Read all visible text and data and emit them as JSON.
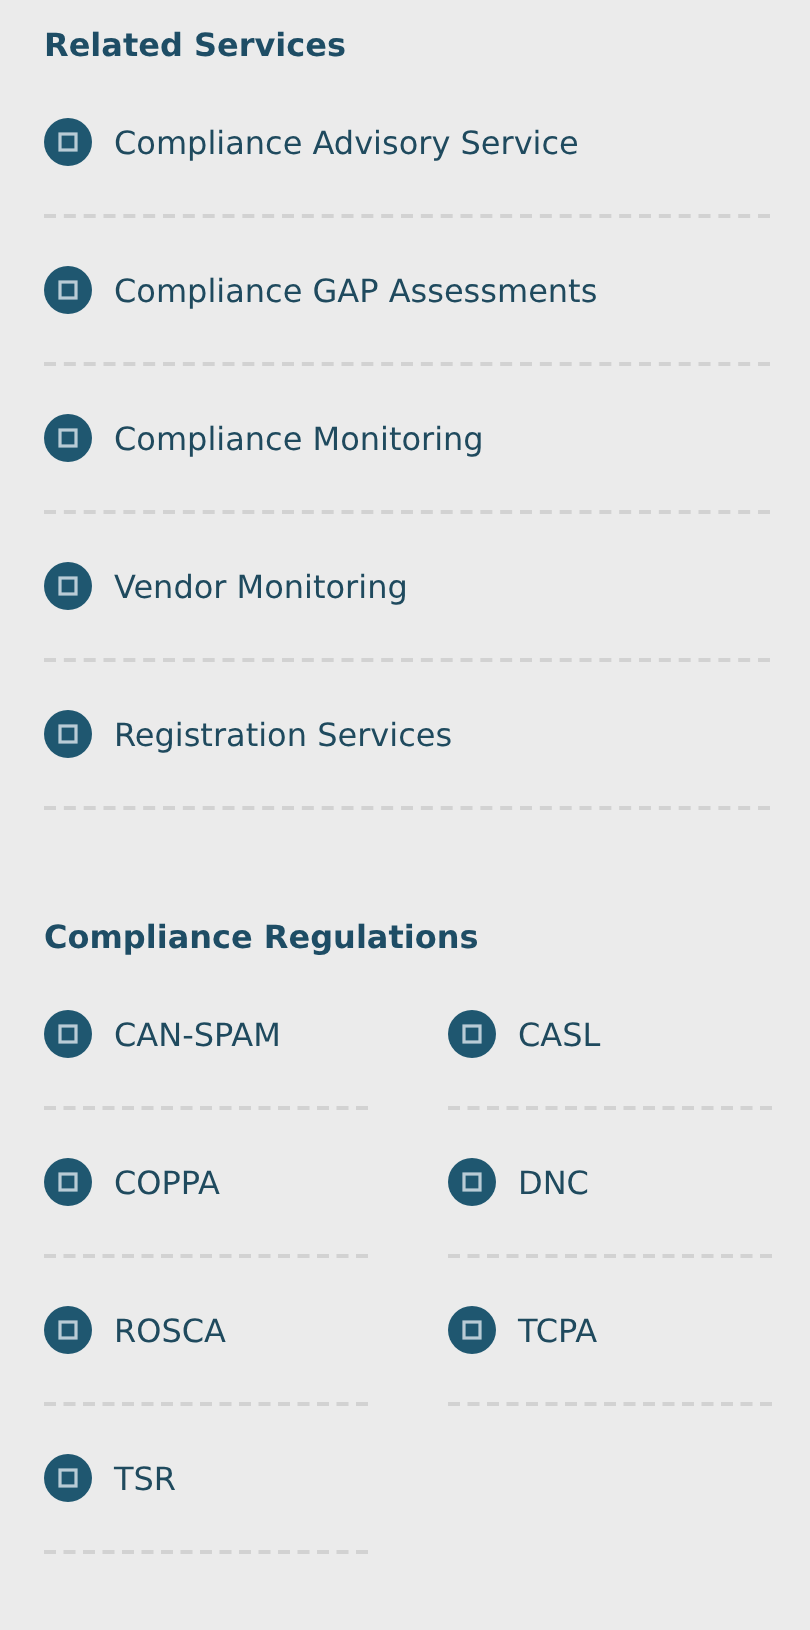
{
  "related_services": {
    "title": "Related Services",
    "items": [
      {
        "label": "Compliance Advisory Service"
      },
      {
        "label": "Compliance GAP Assessments"
      },
      {
        "label": "Compliance Monitoring"
      },
      {
        "label": "Vendor Monitoring"
      },
      {
        "label": "Registration Services"
      }
    ]
  },
  "compliance_regulations": {
    "title": "Compliance Regulations",
    "items": [
      {
        "label": "CAN-SPAM"
      },
      {
        "label": "CASL"
      },
      {
        "label": "COPPA"
      },
      {
        "label": "DNC"
      },
      {
        "label": "ROSCA"
      },
      {
        "label": "TCPA"
      },
      {
        "label": "TSR"
      }
    ]
  }
}
